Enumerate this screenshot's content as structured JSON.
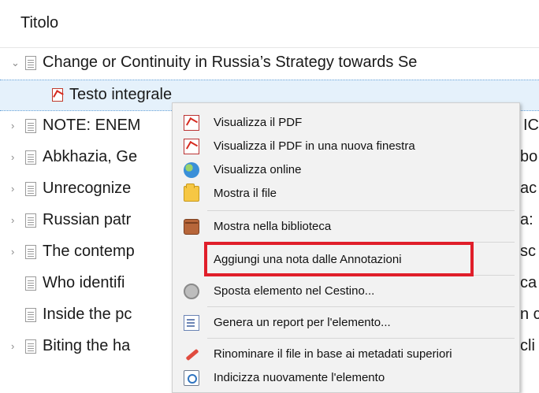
{
  "column": {
    "title": "Titolo"
  },
  "rows": [
    {
      "text": "Change or Continuity in Russia’s Strategy towards Se"
    },
    {
      "text": "Testo integrale"
    },
    {
      "text": "NOTE: ENEM"
    },
    {
      "text": "Abkhazia, Ge"
    },
    {
      "text": "Unrecognize"
    },
    {
      "text": "Russian patr"
    },
    {
      "text": "The contemp"
    },
    {
      "text": "Who identifi"
    },
    {
      "text": "Inside the pc"
    },
    {
      "text": "Biting the ha"
    }
  ],
  "row_suffixes": [
    "IC",
    "bo",
    "ac",
    "a:",
    "sc",
    "ca",
    "n c",
    "cli"
  ],
  "context_menu": {
    "items": [
      {
        "label": "Visualizza il PDF",
        "icon": "pdf-icon"
      },
      {
        "label": "Visualizza il PDF in una nuova finestra",
        "icon": "pdf-icon"
      },
      {
        "label": "Visualizza online",
        "icon": "globe-icon"
      },
      {
        "label": "Mostra il file",
        "icon": "folder-icon"
      },
      {
        "label": "Mostra nella biblioteca",
        "icon": "library-icon"
      },
      {
        "label": "Aggiungi una nota dalle Annotazioni",
        "icon": ""
      },
      {
        "label": "Sposta elemento nel Cestino...",
        "icon": "trash-icon"
      },
      {
        "label": "Genera un report per l'elemento...",
        "icon": "report-icon"
      },
      {
        "label": "Rinominare il file in base ai metadati superiori",
        "icon": "rename-icon"
      },
      {
        "label": "Indicizza nuovamente l'elemento",
        "icon": "reindex-icon"
      }
    ]
  },
  "colors": {
    "highlight": "#e01e2a",
    "selection": "#e5f1fb"
  }
}
